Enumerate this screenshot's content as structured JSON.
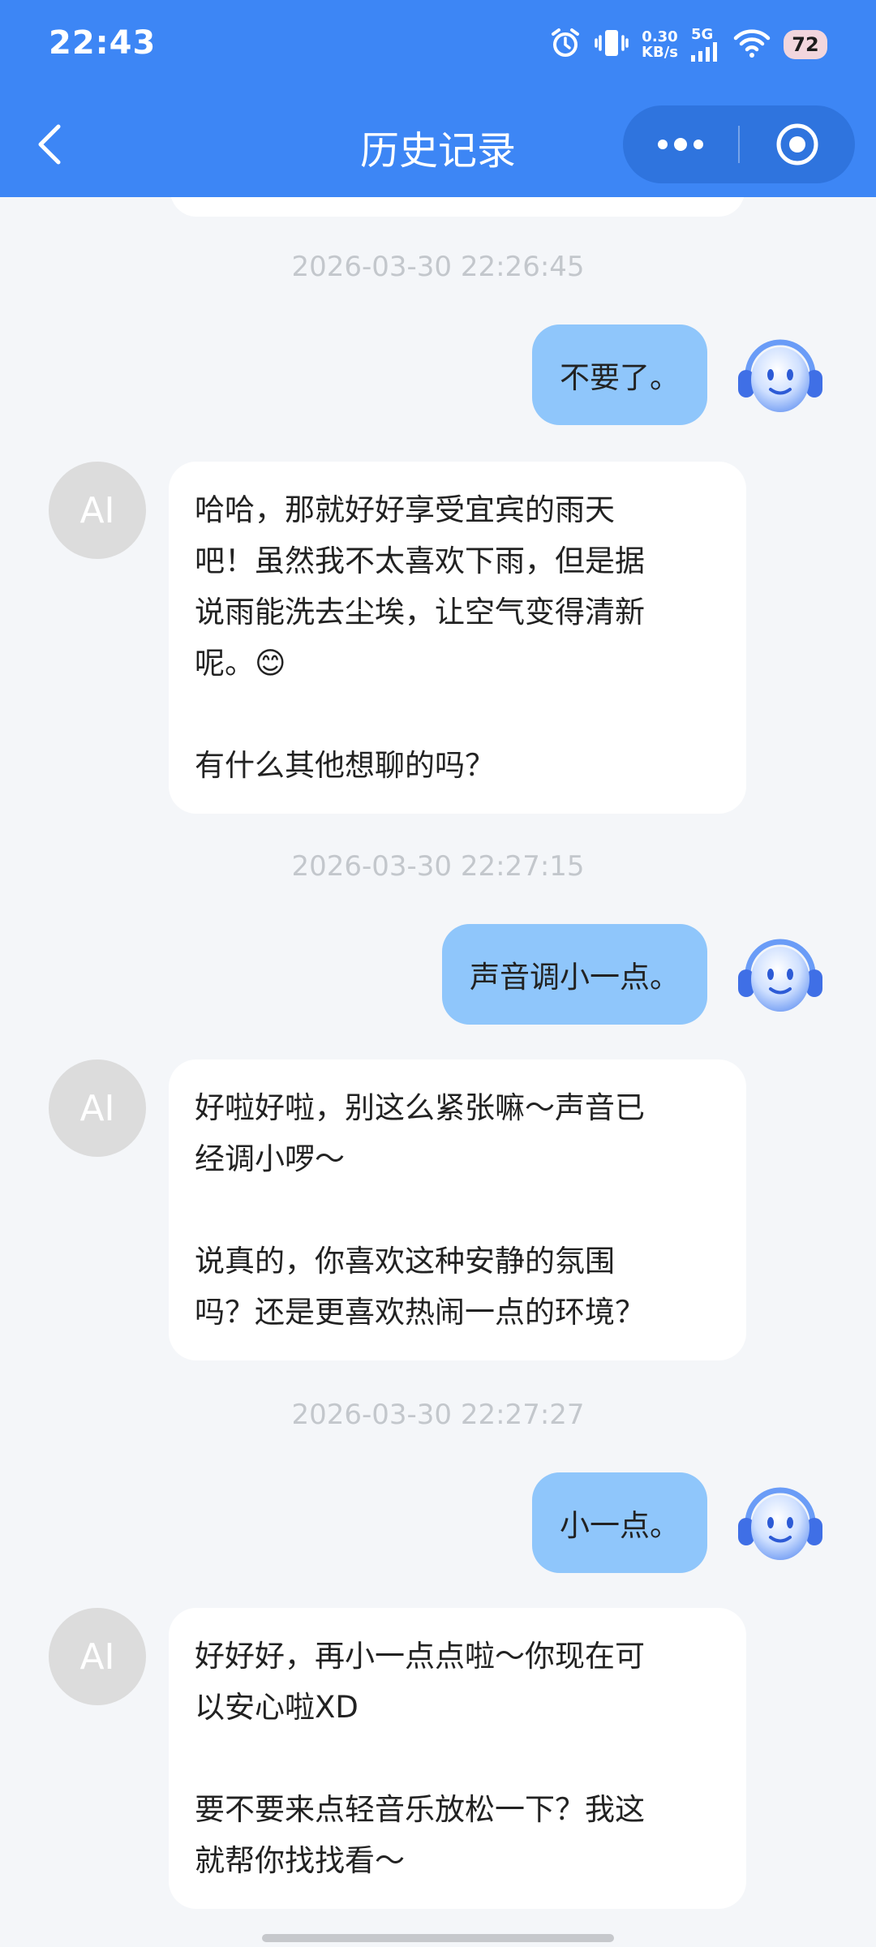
{
  "status_bar": {
    "time": "22:43",
    "net_speed_value": "0.30",
    "net_speed_unit": "KB/s",
    "network_type": "5G",
    "battery": "72",
    "icons": [
      "alarm-icon",
      "vibrate-icon",
      "signal-icon",
      "wifi-icon",
      "battery-icon"
    ]
  },
  "nav": {
    "title": "历史记录",
    "back_icon": "chevron-left-icon",
    "more_icon": "more-icon",
    "close_icon": "target-icon"
  },
  "colors": {
    "header_bg": "#3d86f5",
    "user_bubble": "#8fc6fb",
    "ai_bubble": "#ffffff",
    "page_bg": "#f4f6f9",
    "timestamp": "#c3c7cc"
  },
  "messages": [
    {
      "timestamp": "2026-03-30 22:26:45",
      "user": "不要了。",
      "ai_avatar": "AI",
      "ai_paragraphs": [
        "哈哈，那就好好享受宜宾的雨天",
        "吧！虽然我不太喜欢下雨，但是据",
        "说雨能洗去尘埃，让空气变得清新",
        "呢。😊",
        "",
        "有什么其他想聊的吗？"
      ]
    },
    {
      "timestamp": "2026-03-30 22:27:15",
      "user": "声音调小一点。",
      "ai_avatar": "AI",
      "ai_paragraphs": [
        "好啦好啦，别这么紧张嘛～声音已",
        "经调小啰～",
        "",
        "说真的，你喜欢这种安静的氛围",
        "吗？还是更喜欢热闹一点的环境？"
      ]
    },
    {
      "timestamp": "2026-03-30 22:27:27",
      "user": "小一点。",
      "ai_avatar": "AI",
      "ai_paragraphs": [
        "好好好，再小一点点啦～你现在可",
        "以安心啦XD",
        "",
        "要不要来点轻音乐放松一下？我这",
        "就帮你找找看～"
      ]
    }
  ]
}
